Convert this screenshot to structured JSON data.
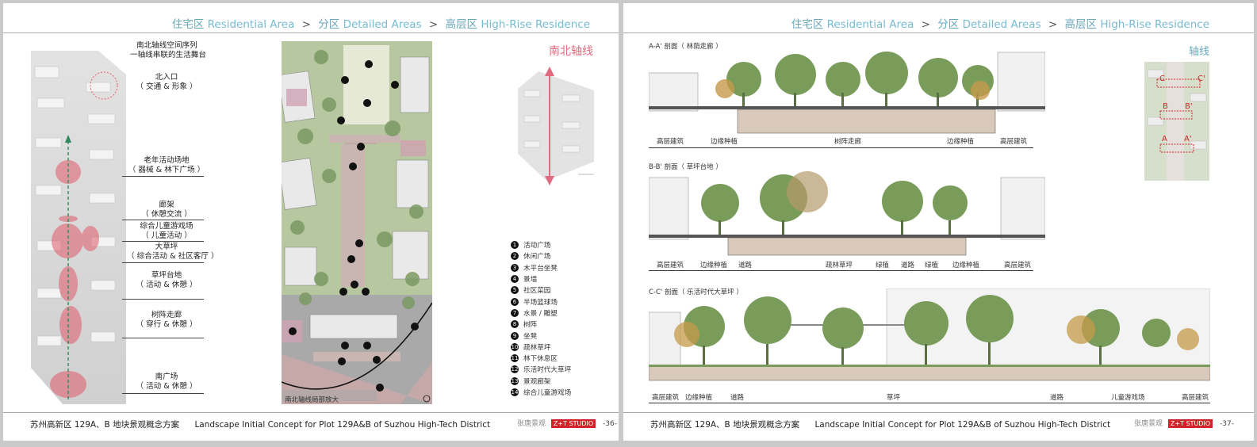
{
  "header": {
    "crumbs": [
      {
        "cn": "住宅区",
        "en": "Residential Area"
      },
      {
        "cn": "分区",
        "en": "Detailed Areas"
      },
      {
        "cn": "高层区",
        "en": "High-Rise Residence"
      }
    ],
    "separator": ">"
  },
  "footer": {
    "cn": "苏州高新区 129A、B 地块景观概念方案",
    "en": "Landscape Initial Concept for Plot 129A&B of Suzhou High-Tech District",
    "brand_cn": "张唐景观",
    "brand_logo": "Z+T STUDIO"
  },
  "left_page": {
    "page_number": "-36-",
    "sequence_title_1": "南北轴线空间序列",
    "sequence_title_2": "一轴线串联的生活舞台",
    "labels": [
      {
        "name": "北入口",
        "desc": "（ 交通 & 形象 ）"
      },
      {
        "name": "老年活动场地",
        "desc": "（ 器械 & 林下广场 ）"
      },
      {
        "name": "廊架",
        "desc": "（ 休憩交流 ）"
      },
      {
        "name": "综合儿童游戏场",
        "desc": "（ 儿童活动 ）"
      },
      {
        "name": "大草坪",
        "desc": "（ 综合活动 & 社区客厅 ）"
      },
      {
        "name": "草坪台地",
        "desc": "（ 活动 & 休憩 ）"
      },
      {
        "name": "树阵走廊",
        "desc": "（ 穿行 & 休憩 ）"
      },
      {
        "name": "南广场",
        "desc": "（ 活动 & 休憩 ）"
      }
    ],
    "plan_caption": "南北轴线局部放大",
    "axis_title": "南北轴线",
    "legend": [
      {
        "n": "1",
        "t": "活动广场"
      },
      {
        "n": "2",
        "t": "休闲广场"
      },
      {
        "n": "3",
        "t": "木平台坐凳"
      },
      {
        "n": "4",
        "t": "景墙"
      },
      {
        "n": "5",
        "t": "社区菜园"
      },
      {
        "n": "6",
        "t": "半场篮球场"
      },
      {
        "n": "7",
        "t": "水景 / 雕塑"
      },
      {
        "n": "8",
        "t": "树阵"
      },
      {
        "n": "9",
        "t": "坐凳"
      },
      {
        "n": "10",
        "t": "疏林草坪"
      },
      {
        "n": "11",
        "t": "林下休息区"
      },
      {
        "n": "12",
        "t": "乐活时代大草坪"
      },
      {
        "n": "13",
        "t": "景观廊架"
      },
      {
        "n": "14",
        "t": "综合儿童游戏场"
      }
    ]
  },
  "right_page": {
    "page_number": "-37-",
    "axis_title": "轴线",
    "key_marks": [
      "C",
      "C'",
      "B",
      "B'",
      "A",
      "A'"
    ],
    "sections": [
      {
        "title": "A-A' 剖面（ 林荫走廊 ）",
        "labels": [
          "高层建筑",
          "边缘种植",
          "树阵走廊",
          "边缘种植",
          "高层建筑"
        ]
      },
      {
        "title": "B-B' 剖面（ 草坪台地 ）",
        "labels": [
          "高层建筑",
          "边缘种植",
          "道路",
          "疏林草坪",
          "绿植",
          "道路",
          "绿植",
          "边缘种植",
          "高层建筑"
        ]
      },
      {
        "title": "C-C' 剖面（ 乐活时代大草坪 ）",
        "labels": [
          "高层建筑",
          "边缘种植",
          "道路",
          "草坪",
          "道路",
          "儿童游戏场",
          "高层建筑"
        ]
      }
    ]
  },
  "colors": {
    "accent": "#6aa7ba",
    "axis": "#e06a7f",
    "brand": "#d2232a"
  }
}
